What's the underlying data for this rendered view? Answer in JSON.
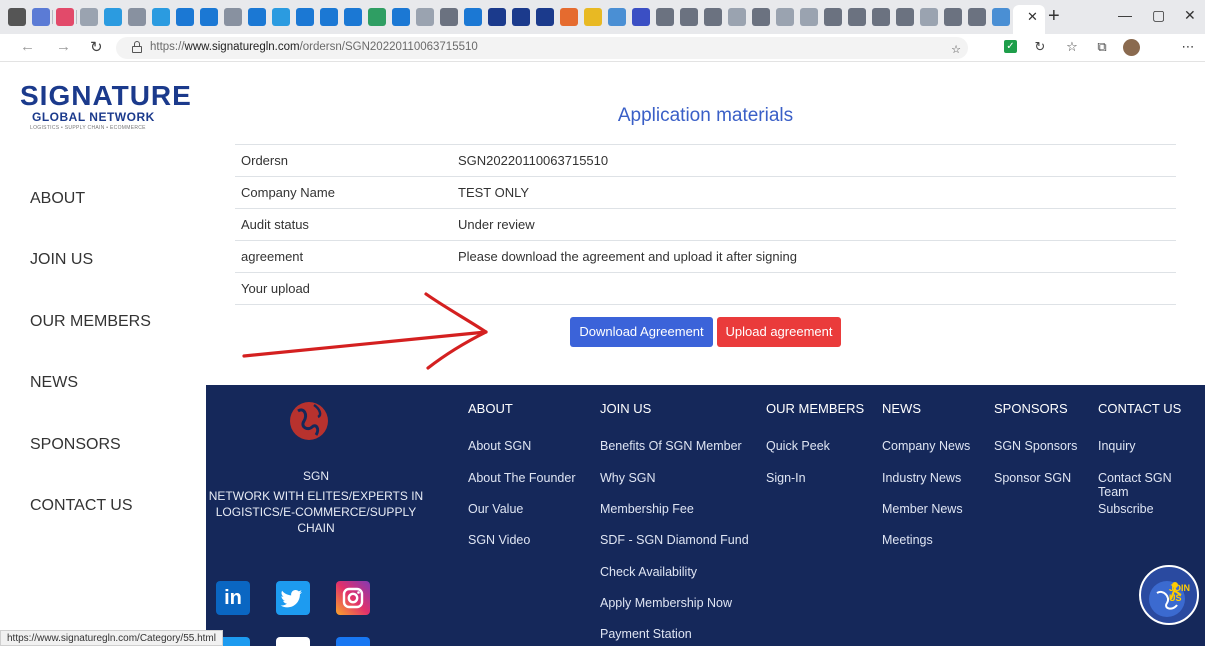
{
  "browser": {
    "url_prefix": "https://",
    "url_host": "www.signaturegln.com",
    "url_path": "/ordersn/SGN20220110063715510",
    "status_url": "https://www.signaturegln.com/Category/55.html"
  },
  "logo": {
    "main": "SIGNATURE",
    "sub": "GLOBAL NETWORK",
    "tag": "LOGISTICS • SUPPLY CHAIN • ECOMMERCE"
  },
  "sidebar": {
    "items": [
      "ABOUT",
      "JOIN US",
      "OUR MEMBERS",
      "NEWS",
      "SPONSORS",
      "CONTACT US"
    ]
  },
  "main": {
    "title": "Application materials",
    "rows": [
      {
        "key": "Ordersn",
        "value": "SGN20220110063715510"
      },
      {
        "key": "Company Name",
        "value": "TEST ONLY"
      },
      {
        "key": "Audit status",
        "value": "Under review"
      },
      {
        "key": "agreement",
        "value": "Please download the agreement and upload it after signing"
      },
      {
        "key": "Your upload",
        "value": ""
      }
    ],
    "download_label": "Download Agreement",
    "upload_label": "Upload agreement"
  },
  "footer": {
    "sgn_label": "SGN",
    "sgn_desc": "NETWORK WITH ELITES/EXPERTS IN LOGISTICS/E-COMMERCE/SUPPLY CHAIN",
    "columns": [
      {
        "head": "ABOUT",
        "links": [
          "About SGN",
          "About The Founder",
          "Our Value",
          "SGN Video"
        ]
      },
      {
        "head": "JOIN US",
        "links": [
          "Benefits Of SGN Member",
          "Why SGN",
          "Membership Fee",
          "SDF - SGN Diamond Fund",
          "Check Availability",
          "Apply Membership Now",
          "Payment Station"
        ]
      },
      {
        "head": "OUR MEMBERS",
        "links": [
          "Quick Peek",
          "Sign-In"
        ]
      },
      {
        "head": "NEWS",
        "links": [
          "Company News",
          "Industry News",
          "Member News",
          "Meetings"
        ]
      },
      {
        "head": "SPONSORS",
        "links": [
          "SGN Sponsors",
          "Sponsor SGN"
        ]
      },
      {
        "head": "CONTACT US",
        "links": [
          "Inquiry",
          "Contact SGN Team",
          "Subscribe"
        ]
      }
    ],
    "join_badge": "JOIN US"
  },
  "colors": {
    "footer_bg": "#15285a",
    "title_blue": "#3a5fc7",
    "download_blue": "#3b63d9",
    "upload_red": "#ea3b3b",
    "annotation_red": "#d42020"
  }
}
